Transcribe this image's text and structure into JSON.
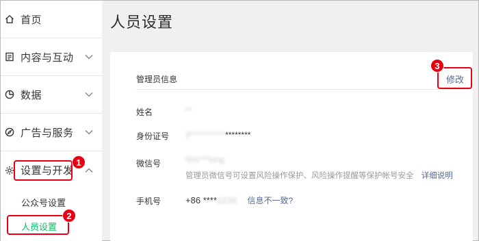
{
  "sidebar": {
    "items": [
      {
        "label": "首页",
        "icon": "home-icon"
      },
      {
        "label": "内容与互动",
        "icon": "document-icon"
      },
      {
        "label": "数据",
        "icon": "pie-chart-icon"
      },
      {
        "label": "广告与服务",
        "icon": "compass-icon"
      },
      {
        "label": "设置与开发",
        "icon": "gear-icon"
      }
    ],
    "sub_items": [
      {
        "label": "公众号设置"
      },
      {
        "label": "人员设置"
      }
    ]
  },
  "annotations": {
    "badge1": "1",
    "badge2": "2",
    "badge3": "3"
  },
  "main": {
    "page_title": "人员设置",
    "section_title": "管理员信息",
    "edit_label": "修改",
    "rows": {
      "name_label": "姓名",
      "name_value": "**",
      "id_label": "身份证号",
      "id_prefix": "3****",
      "id_masked": "*******",
      "id_suffix": "********",
      "wechat_label": "微信号",
      "wechat_value": "Wxi***lang",
      "wechat_hint": "管理员微信号可设置风险操作保护、风险操作提醒等保护帐号安全",
      "wechat_detail_link": "详细说明",
      "phone_label": "手机号",
      "phone_prefix": "+86",
      "phone_masked": "****",
      "phone_hidden": "1234",
      "phone_mismatch_link": "信息不一致?"
    }
  },
  "colors": {
    "accent_green": "#07c160",
    "link_blue": "#576b95",
    "annotation_red": "#e60012"
  }
}
